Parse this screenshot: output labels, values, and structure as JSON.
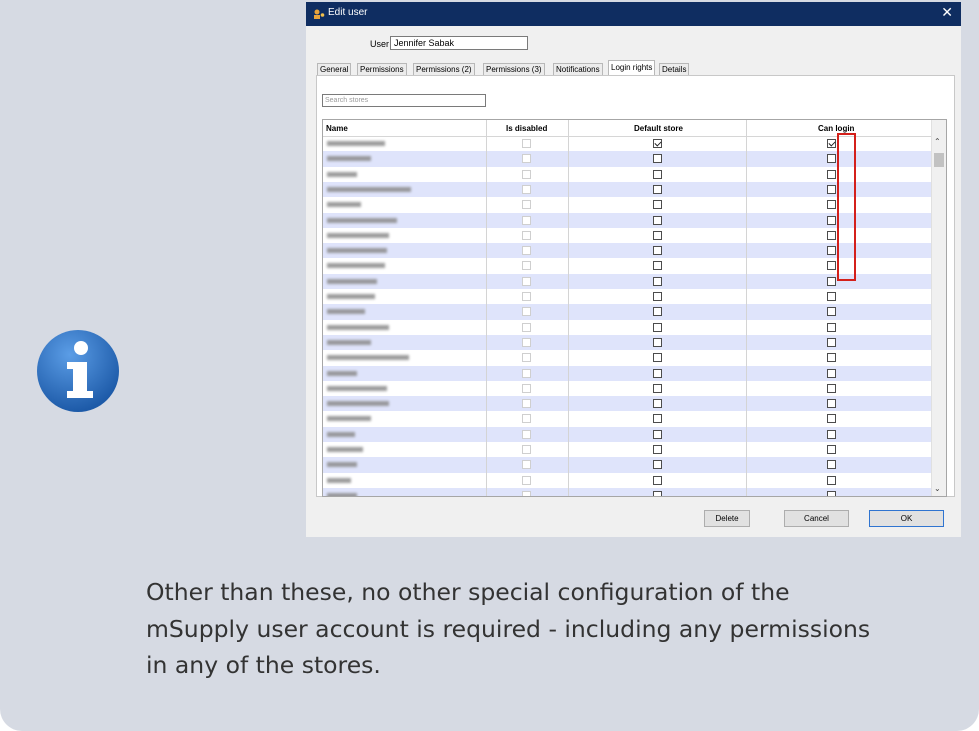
{
  "dialog": {
    "title": "Edit user",
    "user_label": "User",
    "user_value": "Jennifer Sabak",
    "tabs": [
      {
        "label": "General",
        "active": false
      },
      {
        "label": "Permissions",
        "active": false
      },
      {
        "label": "Permissions (2)",
        "active": false
      },
      {
        "label": "Permissions (3)",
        "active": false
      },
      {
        "label": "Notifications",
        "active": false
      },
      {
        "label": "Login rights",
        "active": true
      },
      {
        "label": "Details",
        "active": false
      }
    ],
    "search_placeholder": "Search stores",
    "columns": {
      "name": "Name",
      "is_disabled": "Is disabled",
      "default_store": "Default store",
      "can_login": "Can login"
    },
    "rows": [
      {
        "is_disabled": false,
        "default_store": true,
        "can_login": true
      },
      {
        "is_disabled": false,
        "default_store": false,
        "can_login": false
      },
      {
        "is_disabled": false,
        "default_store": false,
        "can_login": false
      },
      {
        "is_disabled": false,
        "default_store": false,
        "can_login": false
      },
      {
        "is_disabled": false,
        "default_store": false,
        "can_login": false
      },
      {
        "is_disabled": false,
        "default_store": false,
        "can_login": false
      },
      {
        "is_disabled": false,
        "default_store": false,
        "can_login": false
      },
      {
        "is_disabled": false,
        "default_store": false,
        "can_login": false
      },
      {
        "is_disabled": false,
        "default_store": false,
        "can_login": false
      },
      {
        "is_disabled": false,
        "default_store": false,
        "can_login": false
      },
      {
        "is_disabled": false,
        "default_store": false,
        "can_login": false
      },
      {
        "is_disabled": false,
        "default_store": false,
        "can_login": false
      },
      {
        "is_disabled": false,
        "default_store": false,
        "can_login": false
      },
      {
        "is_disabled": false,
        "default_store": false,
        "can_login": false
      },
      {
        "is_disabled": false,
        "default_store": false,
        "can_login": false
      },
      {
        "is_disabled": false,
        "default_store": false,
        "can_login": false
      },
      {
        "is_disabled": false,
        "default_store": false,
        "can_login": false
      },
      {
        "is_disabled": false,
        "default_store": false,
        "can_login": false
      },
      {
        "is_disabled": false,
        "default_store": false,
        "can_login": false
      },
      {
        "is_disabled": false,
        "default_store": false,
        "can_login": false
      },
      {
        "is_disabled": false,
        "default_store": false,
        "can_login": false
      },
      {
        "is_disabled": false,
        "default_store": false,
        "can_login": false
      },
      {
        "is_disabled": false,
        "default_store": false,
        "can_login": false
      },
      {
        "is_disabled": false,
        "default_store": false,
        "can_login": false
      }
    ],
    "buttons": {
      "delete": "Delete",
      "cancel": "Cancel",
      "ok": "OK"
    }
  },
  "note": {
    "lines": [
      "Other than these, no other special configuration of the",
      "mSupply user account is required - including any permissions",
      "in any of the stores."
    ]
  },
  "colors": {
    "note_background": "#d6dae3",
    "titlebar": "#0f2d61",
    "row_alternate": "#dfe4fb",
    "highlight": "#d4201b",
    "info_icon": "#2b6cb8"
  },
  "icons": {
    "note": "info-icon",
    "app": "msupply-app-icon"
  }
}
